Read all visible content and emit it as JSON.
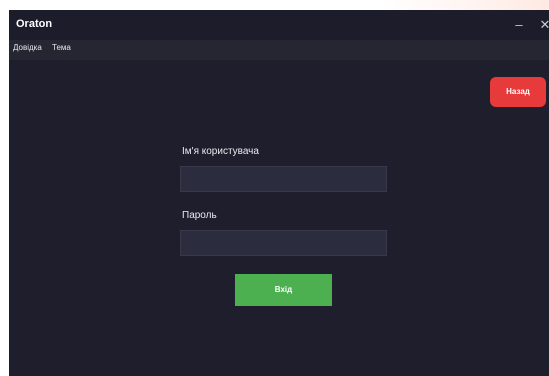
{
  "app": {
    "title": "Oraton"
  },
  "window_controls": {
    "minimize": "–",
    "close": "✕"
  },
  "menu": {
    "items": [
      "Довідка",
      "Тема"
    ]
  },
  "back_button": {
    "label": "Назад",
    "color": "#e73a3a"
  },
  "form": {
    "username_label": "Ім'я користувача",
    "username_value": "",
    "password_label": "Пароль",
    "password_value": "",
    "submit_label": "Вхід",
    "submit_color": "#4caf50"
  },
  "theme": {
    "background": "#1e1e2d",
    "input_background": "#2b2c3d"
  }
}
